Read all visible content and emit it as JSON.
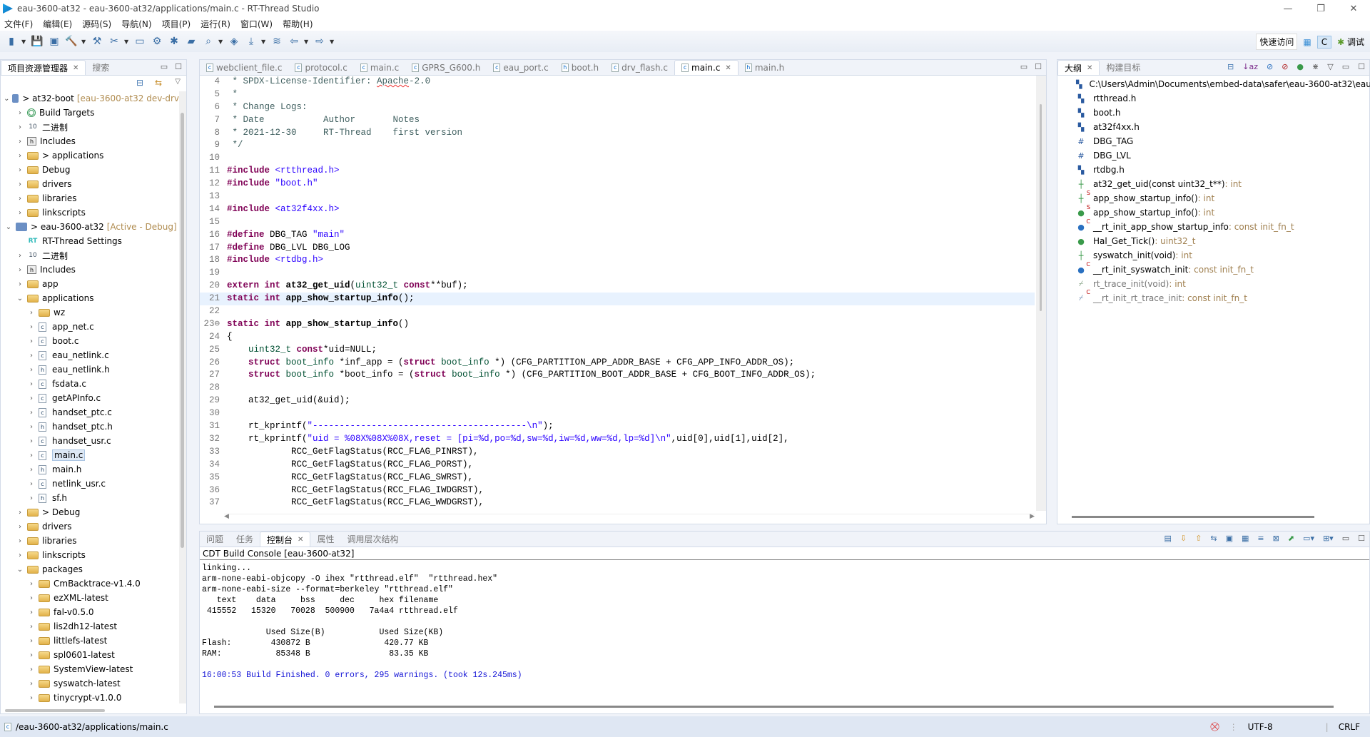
{
  "window": {
    "title": "eau-3600-at32 - eau-3600-at32/applications/main.c - RT-Thread Studio",
    "min": "—",
    "max": "❐",
    "close": "✕"
  },
  "menu": [
    "文件(F)",
    "编辑(E)",
    "源码(S)",
    "导航(N)",
    "项目(P)",
    "运行(R)",
    "窗口(W)",
    "帮助(H)"
  ],
  "toolbar": {
    "icons": [
      "new-project-icon",
      "save-icon",
      "save-all-icon",
      "build-icon",
      "rebuild-icon",
      "clean-icon",
      "monitor-icon",
      "settings-icon",
      "debug-icon",
      "open-folder-icon",
      "search-icon",
      "notebook-icon",
      "download-icon",
      "layers-icon",
      "back-icon",
      "forward-icon"
    ],
    "quick_access": "快速访问",
    "perspective_c": "C",
    "perspective_debug": "调试"
  },
  "project_explorer": {
    "tabs": [
      {
        "label": "项目资源管理器",
        "active": true
      },
      {
        "label": "搜索",
        "active": false
      }
    ],
    "items": [
      {
        "d": 0,
        "a": "open",
        "i": "proj",
        "label": "> at32-boot",
        "deco": "[eau-3600-at32 dev-drv"
      },
      {
        "d": 1,
        "a": "closed",
        "i": "target",
        "label": "Build Targets"
      },
      {
        "d": 1,
        "a": "closed",
        "i": "bin",
        "label": "二进制"
      },
      {
        "d": 1,
        "a": "closed",
        "i": "inc",
        "label": "Includes"
      },
      {
        "d": 1,
        "a": "closed",
        "i": "folder",
        "label": "> applications"
      },
      {
        "d": 1,
        "a": "closed",
        "i": "folder",
        "label": "Debug"
      },
      {
        "d": 1,
        "a": "closed",
        "i": "folder",
        "label": "drivers"
      },
      {
        "d": 1,
        "a": "closed",
        "i": "folder",
        "label": "libraries"
      },
      {
        "d": 1,
        "a": "closed",
        "i": "folder",
        "label": "linkscripts"
      },
      {
        "d": 0,
        "a": "open",
        "i": "proj",
        "label": "> eau-3600-at32",
        "deco": "[Active - Debug]"
      },
      {
        "d": 1,
        "a": "none",
        "i": "rt",
        "label": "RT-Thread Settings"
      },
      {
        "d": 1,
        "a": "closed",
        "i": "bin",
        "label": "二进制"
      },
      {
        "d": 1,
        "a": "closed",
        "i": "inc",
        "label": "Includes"
      },
      {
        "d": 1,
        "a": "closed",
        "i": "folder",
        "label": "app"
      },
      {
        "d": 1,
        "a": "open",
        "i": "folder",
        "label": "applications"
      },
      {
        "d": 2,
        "a": "closed",
        "i": "folder",
        "label": "wz"
      },
      {
        "d": 2,
        "a": "closed",
        "i": "cfile",
        "label": "app_net.c"
      },
      {
        "d": 2,
        "a": "closed",
        "i": "cfile",
        "label": "boot.c"
      },
      {
        "d": 2,
        "a": "closed",
        "i": "cfile",
        "label": "eau_netlink.c"
      },
      {
        "d": 2,
        "a": "closed",
        "i": "hfile",
        "label": "eau_netlink.h"
      },
      {
        "d": 2,
        "a": "closed",
        "i": "cfile",
        "label": "fsdata.c"
      },
      {
        "d": 2,
        "a": "closed",
        "i": "cfile",
        "label": "getAPInfo.c"
      },
      {
        "d": 2,
        "a": "closed",
        "i": "cfile",
        "label": "handset_ptc.c"
      },
      {
        "d": 2,
        "a": "closed",
        "i": "hfile",
        "label": "handset_ptc.h"
      },
      {
        "d": 2,
        "a": "closed",
        "i": "cfile",
        "label": "handset_usr.c"
      },
      {
        "d": 2,
        "a": "closed",
        "i": "cfile",
        "label": "main.c",
        "sel": true
      },
      {
        "d": 2,
        "a": "closed",
        "i": "hfile",
        "label": "main.h"
      },
      {
        "d": 2,
        "a": "closed",
        "i": "cfile",
        "label": "netlink_usr.c"
      },
      {
        "d": 2,
        "a": "closed",
        "i": "hfile",
        "label": "sf.h"
      },
      {
        "d": 1,
        "a": "closed",
        "i": "folder",
        "label": "> Debug"
      },
      {
        "d": 1,
        "a": "closed",
        "i": "folder",
        "label": "drivers"
      },
      {
        "d": 1,
        "a": "closed",
        "i": "folder",
        "label": "libraries"
      },
      {
        "d": 1,
        "a": "closed",
        "i": "folder",
        "label": "linkscripts"
      },
      {
        "d": 1,
        "a": "open",
        "i": "folder",
        "label": "packages"
      },
      {
        "d": 2,
        "a": "closed",
        "i": "folder",
        "label": "CmBacktrace-v1.4.0"
      },
      {
        "d": 2,
        "a": "closed",
        "i": "folder",
        "label": "ezXML-latest"
      },
      {
        "d": 2,
        "a": "closed",
        "i": "folder",
        "label": "fal-v0.5.0"
      },
      {
        "d": 2,
        "a": "closed",
        "i": "folder",
        "label": "lis2dh12-latest"
      },
      {
        "d": 2,
        "a": "closed",
        "i": "folder",
        "label": "littlefs-latest"
      },
      {
        "d": 2,
        "a": "closed",
        "i": "folder",
        "label": "spl0601-latest"
      },
      {
        "d": 2,
        "a": "closed",
        "i": "folder",
        "label": "SystemView-latest"
      },
      {
        "d": 2,
        "a": "closed",
        "i": "folder",
        "label": "syswatch-latest"
      },
      {
        "d": 2,
        "a": "closed",
        "i": "folder",
        "label": "tinycrypt-v1.0.0"
      }
    ]
  },
  "editor": {
    "tabs": [
      {
        "label": "webclient_file.c",
        "t": "c"
      },
      {
        "label": "protocol.c",
        "t": "c"
      },
      {
        "label": "main.c",
        "t": "c"
      },
      {
        "label": "GPRS_G600.h",
        "t": "c"
      },
      {
        "label": "eau_port.c",
        "t": "c"
      },
      {
        "label": "boot.h",
        "t": "h"
      },
      {
        "label": "drv_flash.c",
        "t": "c"
      },
      {
        "label": "main.c",
        "t": "c",
        "active": true
      },
      {
        "label": "main.h",
        "t": "h"
      }
    ],
    "current_line": 21,
    "lines": [
      {
        "n": "4",
        "t": [
          [
            "c",
            " * SPDX-License-Identifier: "
          ],
          [
            "c sq",
            "Apache"
          ],
          [
            "c",
            "-2.0"
          ]
        ]
      },
      {
        "n": "5",
        "t": [
          [
            "c",
            " *"
          ]
        ]
      },
      {
        "n": "6",
        "t": [
          [
            "c",
            " * Change Logs:"
          ]
        ]
      },
      {
        "n": "7",
        "t": [
          [
            "c",
            " * Date           Author       Notes"
          ]
        ]
      },
      {
        "n": "8",
        "t": [
          [
            "c",
            " * 2021-12-30     RT-Thread    first version"
          ]
        ]
      },
      {
        "n": "9",
        "t": [
          [
            "c",
            " */"
          ]
        ]
      },
      {
        "n": "10",
        "t": []
      },
      {
        "n": "11",
        "t": [
          [
            "k",
            "#include "
          ],
          [
            "s",
            "<rtthread.h>"
          ]
        ]
      },
      {
        "n": "12",
        "t": [
          [
            "k",
            "#include "
          ],
          [
            "s",
            "\"boot.h\""
          ]
        ]
      },
      {
        "n": "13",
        "t": []
      },
      {
        "n": "14",
        "t": [
          [
            "k",
            "#include "
          ],
          [
            "s",
            "<at32f4xx.h>"
          ]
        ]
      },
      {
        "n": "15",
        "t": []
      },
      {
        "n": "16",
        "t": [
          [
            "k",
            "#define "
          ],
          [
            "p",
            "DBG_TAG "
          ],
          [
            "s",
            "\"main\""
          ]
        ]
      },
      {
        "n": "17",
        "t": [
          [
            "k",
            "#define "
          ],
          [
            "p",
            "DBG_LVL DBG_LOG"
          ]
        ]
      },
      {
        "n": "18",
        "t": [
          [
            "k",
            "#include "
          ],
          [
            "s",
            "<rtdbg.h>"
          ]
        ]
      },
      {
        "n": "19",
        "t": []
      },
      {
        "n": "20",
        "t": [
          [
            "k",
            "extern int "
          ],
          [
            "f",
            "at32_get_uid"
          ],
          [
            "p",
            "("
          ],
          [
            "ty",
            "uint32_t "
          ],
          [
            "k",
            "const"
          ],
          [
            "p",
            "**buf);"
          ]
        ]
      },
      {
        "n": "21",
        "t": [
          [
            "k",
            "static int "
          ],
          [
            "f",
            "app_show_startup_info"
          ],
          [
            "p",
            "();"
          ]
        ]
      },
      {
        "n": "22",
        "t": []
      },
      {
        "n": "23⊖",
        "t": [
          [
            "k",
            "static int "
          ],
          [
            "f",
            "app_show_startup_info"
          ],
          [
            "p",
            "()"
          ]
        ]
      },
      {
        "n": "24",
        "t": [
          [
            "p",
            "{"
          ]
        ]
      },
      {
        "n": "25",
        "t": [
          [
            "ty",
            "    uint32_t "
          ],
          [
            "k",
            "const"
          ],
          [
            "p",
            "*uid=NULL;"
          ]
        ]
      },
      {
        "n": "26",
        "t": [
          [
            "k",
            "    struct "
          ],
          [
            "ty",
            "boot_info "
          ],
          [
            "p",
            "*inf_app = ("
          ],
          [
            "k",
            "struct "
          ],
          [
            "ty",
            "boot_info "
          ],
          [
            "p",
            "*) (CFG_PARTITION_APP_ADDR_BASE + CFG_APP_INFO_ADDR_OS);"
          ]
        ]
      },
      {
        "n": "27",
        "t": [
          [
            "k",
            "    struct "
          ],
          [
            "ty",
            "boot_info "
          ],
          [
            "p",
            "*boot_info = ("
          ],
          [
            "k",
            "struct "
          ],
          [
            "ty",
            "boot_info "
          ],
          [
            "p",
            "*) (CFG_PARTITION_BOOT_ADDR_BASE + CFG_BOOT_INFO_ADDR_OS);"
          ]
        ]
      },
      {
        "n": "28",
        "t": []
      },
      {
        "n": "29",
        "t": [
          [
            "p",
            "    at32_get_uid(&uid);"
          ]
        ]
      },
      {
        "n": "30",
        "t": []
      },
      {
        "n": "31",
        "t": [
          [
            "p",
            "    rt_kprintf("
          ],
          [
            "s",
            "\"----------------------------------------\\n\""
          ],
          [
            "p",
            ");"
          ]
        ]
      },
      {
        "n": "32",
        "t": [
          [
            "p",
            "    rt_kprintf("
          ],
          [
            "s",
            "\"uid = %08X%08X%08X,reset = [pi=%d,po=%d,sw=%d,iw=%d,ww=%d,lp=%d]\\n\""
          ],
          [
            "p",
            ",uid[0],uid[1],uid[2],"
          ]
        ]
      },
      {
        "n": "33",
        "t": [
          [
            "p",
            "            RCC_GetFlagStatus(RCC_FLAG_PINRST),"
          ]
        ]
      },
      {
        "n": "34",
        "t": [
          [
            "p",
            "            RCC_GetFlagStatus(RCC_FLAG_PORST),"
          ]
        ]
      },
      {
        "n": "35",
        "t": [
          [
            "p",
            "            RCC_GetFlagStatus(RCC_FLAG_SWRST),"
          ]
        ]
      },
      {
        "n": "36",
        "t": [
          [
            "p",
            "            RCC_GetFlagStatus(RCC_FLAG_IWDGRST),"
          ]
        ]
      },
      {
        "n": "37",
        "t": [
          [
            "p",
            "            RCC_GetFlagStatus(RCC_FLAG_WWDGRST),"
          ]
        ]
      }
    ]
  },
  "outline": {
    "tabs": [
      {
        "label": "大纲",
        "active": true
      },
      {
        "label": "构建目标",
        "active": false
      }
    ],
    "items": [
      {
        "i": "include",
        "label": "C:\\Users\\Admin\\Documents\\embed-data\\safer\\eau-3600-at32\\eau"
      },
      {
        "i": "include",
        "label": "rtthread.h"
      },
      {
        "i": "include",
        "label": "boot.h"
      },
      {
        "i": "include",
        "label": "at32f4xx.h"
      },
      {
        "i": "macro",
        "label": "DBG_TAG"
      },
      {
        "i": "macro",
        "label": "DBG_LVL"
      },
      {
        "i": "include",
        "label": "rtdbg.h"
      },
      {
        "i": "func-decl",
        "label": "at32_get_uid(const uint32_t**)",
        "type": " : int"
      },
      {
        "i": "func-decl",
        "sup": "S",
        "label": "app_show_startup_info()",
        "type": " : int"
      },
      {
        "i": "func",
        "sup": "S",
        "label": "app_show_startup_info()",
        "type": " : int"
      },
      {
        "i": "var",
        "sup": "C",
        "label": "__rt_init_app_show_startup_info",
        "type": " : const init_fn_t"
      },
      {
        "i": "func",
        "label": "Hal_Get_Tick()",
        "type": " : uint32_t"
      },
      {
        "i": "func-decl",
        "label": "syswatch_init(void)",
        "type": " : int"
      },
      {
        "i": "var",
        "sup": "C",
        "label": "__rt_init_syswatch_init",
        "type": " : const init_fn_t"
      },
      {
        "i": "inactive-func",
        "label": "rt_trace_init(void)",
        "type": " : int",
        "dim": true
      },
      {
        "i": "inactive-var",
        "sup": "C",
        "label": "__rt_init_rt_trace_init",
        "type": " : const init_fn_t",
        "dim": true
      }
    ]
  },
  "bottom": {
    "tabs": [
      {
        "label": "问题",
        "active": false
      },
      {
        "label": "任务",
        "active": false
      },
      {
        "label": "控制台",
        "active": true
      },
      {
        "label": "属性",
        "active": false
      },
      {
        "label": "调用层次结构",
        "active": false
      }
    ],
    "console_title": "CDT Build Console [eau-3600-at32]",
    "console_lines": [
      "linking...",
      "arm-none-eabi-objcopy -O ihex \"rtthread.elf\"  \"rtthread.hex\"",
      "arm-none-eabi-size --format=berkeley \"rtthread.elf\"",
      "   text    data     bss     dec     hex filename",
      " 415552   15320   70028  500900   7a4a4 rtthread.elf",
      "",
      "             Used Size(B)           Used Size(KB)",
      "Flash:        430872 B               420.77 KB",
      "RAM:           85348 B                83.35 KB",
      ""
    ],
    "console_finish": "16:00:53 Build Finished. 0 errors, 295 warnings. (took 12s.245ms)"
  },
  "status": {
    "path": "/eau-3600-at32/applications/main.c",
    "encoding": "UTF-8",
    "line_ending": "CRLF"
  },
  "colors": {
    "keyword": "#7f0055",
    "string": "#2a00ff",
    "comment": "#3f5f5f",
    "accent": "#3a6ea5"
  }
}
